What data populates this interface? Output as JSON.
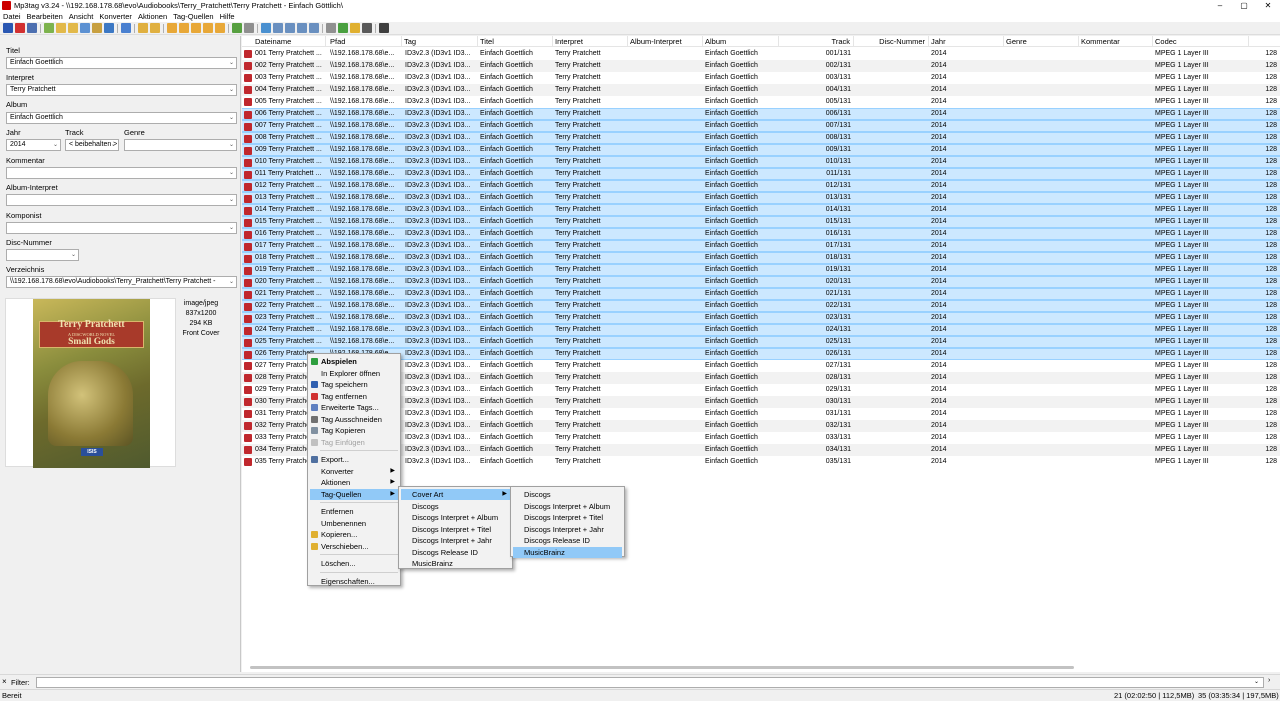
{
  "window": {
    "title": "Mp3tag v3.24  -  \\\\192.168.178.68\\evo\\Audiobooks\\Terry_Pratchett\\Terry Pratchett - Einfach Göttlich\\"
  },
  "menubar": [
    "Datei",
    "Bearbeiten",
    "Ansicht",
    "Konverter",
    "Aktionen",
    "Tag-Quellen",
    "Hilfe"
  ],
  "left": {
    "titel_label": "Titel",
    "titel_value": "Einfach Goettlich",
    "interpret_label": "Interpret",
    "interpret_value": "Terry Pratchett",
    "album_label": "Album",
    "album_value": "Einfach Goettlich",
    "jahr_label": "Jahr",
    "jahr_value": "2014",
    "track_label": "Track",
    "track_value": "< beibehalten >",
    "genre_label": "Genre",
    "genre_value": "",
    "kommentar_label": "Kommentar",
    "kommentar_value": "",
    "albuminterpret_label": "Album-Interpret",
    "albuminterpret_value": "",
    "komponist_label": "Komponist",
    "komponist_value": "",
    "disc_label": "Disc-Nummer",
    "disc_value": "",
    "verz_label": "Verzeichnis",
    "verz_value": "\\\\192.168.178.68\\evo\\Audiobooks\\Terry_Pratchett\\Terry Pratchett -",
    "cover": {
      "mime": "image/jpeg",
      "size": "837x1200",
      "bytes": "294 KB",
      "type": "Front Cover",
      "author": "Terry Pratchett",
      "series": "A DISCWORLD NOVEL",
      "book_title": "Small Gods",
      "publisher": "ISIS"
    }
  },
  "columns": [
    "Dateiname",
    "Pfad",
    "Tag",
    "Titel",
    "Interpret",
    "Album-Interpret",
    "Album",
    "Track",
    "Disc-Nummer",
    "Jahr",
    "Genre",
    "Kommentar",
    "Codec"
  ],
  "row_common": {
    "pfad": "\\\\192.168.178.68\\e...",
    "tag": "ID3v2.3 (ID3v1 ID3...",
    "titel": "Einfach Goettlich",
    "interpret": "Terry Pratchett",
    "album": "Einfach Goettlich",
    "jahr": "2014",
    "codec": "MPEG 1 Layer III",
    "bitrate": "128"
  },
  "rows": [
    {
      "name": "001 Terry Pratchett ...",
      "track": "001/131",
      "selected": false
    },
    {
      "name": "002 Terry Pratchett ...",
      "track": "002/131",
      "selected": false
    },
    {
      "name": "003 Terry Pratchett ...",
      "track": "003/131",
      "selected": false
    },
    {
      "name": "004 Terry Pratchett ...",
      "track": "004/131",
      "selected": false
    },
    {
      "name": "005 Terry Pratchett ...",
      "track": "005/131",
      "selected": false
    },
    {
      "name": "006 Terry Pratchett ...",
      "track": "006/131",
      "selected": true
    },
    {
      "name": "007 Terry Pratchett ...",
      "track": "007/131",
      "selected": true
    },
    {
      "name": "008 Terry Pratchett ...",
      "track": "008/131",
      "selected": true
    },
    {
      "name": "009 Terry Pratchett ...",
      "track": "009/131",
      "selected": true
    },
    {
      "name": "010 Terry Pratchett ...",
      "track": "010/131",
      "selected": true
    },
    {
      "name": "011 Terry Pratchett ...",
      "track": "011/131",
      "selected": true
    },
    {
      "name": "012 Terry Pratchett ...",
      "track": "012/131",
      "selected": true
    },
    {
      "name": "013 Terry Pratchett ...",
      "track": "013/131",
      "selected": true
    },
    {
      "name": "014 Terry Pratchett ...",
      "track": "014/131",
      "selected": true
    },
    {
      "name": "015 Terry Pratchett ...",
      "track": "015/131",
      "selected": true
    },
    {
      "name": "016 Terry Pratchett ...",
      "track": "016/131",
      "selected": true
    },
    {
      "name": "017 Terry Pratchett ...",
      "track": "017/131",
      "selected": true
    },
    {
      "name": "018 Terry Pratchett ...",
      "track": "018/131",
      "selected": true
    },
    {
      "name": "019 Terry Pratchett ...",
      "track": "019/131",
      "selected": true
    },
    {
      "name": "020 Terry Pratchett ...",
      "track": "020/131",
      "selected": true
    },
    {
      "name": "021 Terry Pratchett ...",
      "track": "021/131",
      "selected": true
    },
    {
      "name": "022 Terry Pratchett ...",
      "track": "022/131",
      "selected": true
    },
    {
      "name": "023 Terry Pratchett ...",
      "track": "023/131",
      "selected": true
    },
    {
      "name": "024 Terry Pratchett ...",
      "track": "024/131",
      "selected": true
    },
    {
      "name": "025 Terry Pratchett ...",
      "track": "025/131",
      "selected": true
    },
    {
      "name": "026 Terry Pratchett",
      "track": "026/131",
      "selected": true
    },
    {
      "name": "027 Terry Pratchett",
      "track": "027/131",
      "selected": false
    },
    {
      "name": "028 Terry Pratchett",
      "track": "028/131",
      "selected": false
    },
    {
      "name": "029 Terry Pratchett",
      "track": "029/131",
      "selected": false
    },
    {
      "name": "030 Terry Pratchett",
      "track": "030/131",
      "selected": false
    },
    {
      "name": "031 Terry Pratchett",
      "track": "031/131",
      "selected": false
    },
    {
      "name": "032 Terry Pratchett",
      "track": "032/131",
      "selected": false
    },
    {
      "name": "033 Terry Pratchett",
      "track": "033/131",
      "selected": false
    },
    {
      "name": "034 Terry Pratchett",
      "track": "034/131",
      "selected": false
    },
    {
      "name": "035 Terry Pratchett",
      "track": "035/131",
      "selected": false
    }
  ],
  "context_menu": [
    {
      "label": "Abspielen",
      "bold": true,
      "icon": "play-icon",
      "color": "#2e9e3e"
    },
    {
      "label": "In Explorer öffnen"
    },
    {
      "label": "Tag speichern",
      "icon": "save-icon",
      "color": "#3060b0"
    },
    {
      "label": "Tag entfernen",
      "icon": "remove-icon",
      "color": "#d03030"
    },
    {
      "label": "Erweiterte Tags...",
      "icon": "tags-icon",
      "color": "#6080c0"
    },
    {
      "label": "Tag Ausschneiden",
      "icon": "cut-icon",
      "color": "#707070"
    },
    {
      "label": "Tag Kopieren",
      "icon": "copy-icon",
      "color": "#8090a0"
    },
    {
      "label": "Tag Einfügen",
      "disabled": true,
      "icon": "paste-icon",
      "color": "#c0c0c0"
    },
    {
      "sep": true
    },
    {
      "label": "Export...",
      "icon": "export-icon",
      "color": "#5070a0"
    },
    {
      "label": "Konverter",
      "sub": true
    },
    {
      "label": "Aktionen",
      "sub": true
    },
    {
      "label": "Tag-Quellen",
      "sub": true,
      "highlight": true
    },
    {
      "sep": true
    },
    {
      "label": "Entfernen"
    },
    {
      "label": "Umbenennen"
    },
    {
      "label": "Kopieren...",
      "icon": "folder-copy-icon",
      "color": "#e0b030"
    },
    {
      "label": "Verschieben...",
      "icon": "folder-move-icon",
      "color": "#e0b030"
    },
    {
      "sep": true
    },
    {
      "label": "Löschen..."
    },
    {
      "sep": true
    },
    {
      "label": "Eigenschaften..."
    }
  ],
  "sub_menu1": [
    {
      "label": "Cover Art",
      "sub": true,
      "highlight": true
    },
    {
      "label": "Discogs"
    },
    {
      "label": "Discogs Interpret + Album"
    },
    {
      "label": "Discogs Interpret + Titel"
    },
    {
      "label": "Discogs Interpret + Jahr"
    },
    {
      "label": "Discogs Release ID"
    },
    {
      "label": "MusicBrainz"
    }
  ],
  "sub_menu2": [
    {
      "label": "Discogs"
    },
    {
      "label": "Discogs Interpret + Album"
    },
    {
      "label": "Discogs Interpret + Titel"
    },
    {
      "label": "Discogs Interpret + Jahr"
    },
    {
      "label": "Discogs Release ID"
    },
    {
      "label": "MusicBrainz",
      "highlight": true
    }
  ],
  "filter": {
    "label": "Filter:"
  },
  "status": {
    "left": "Bereit",
    "sel": "21 (02:02:50 | 112,5MB)",
    "total": "35 (03:35:34 | 197,5MB)"
  },
  "colors": {
    "selection": "#cce8ff",
    "menu_highlight": "#91c9f7"
  }
}
